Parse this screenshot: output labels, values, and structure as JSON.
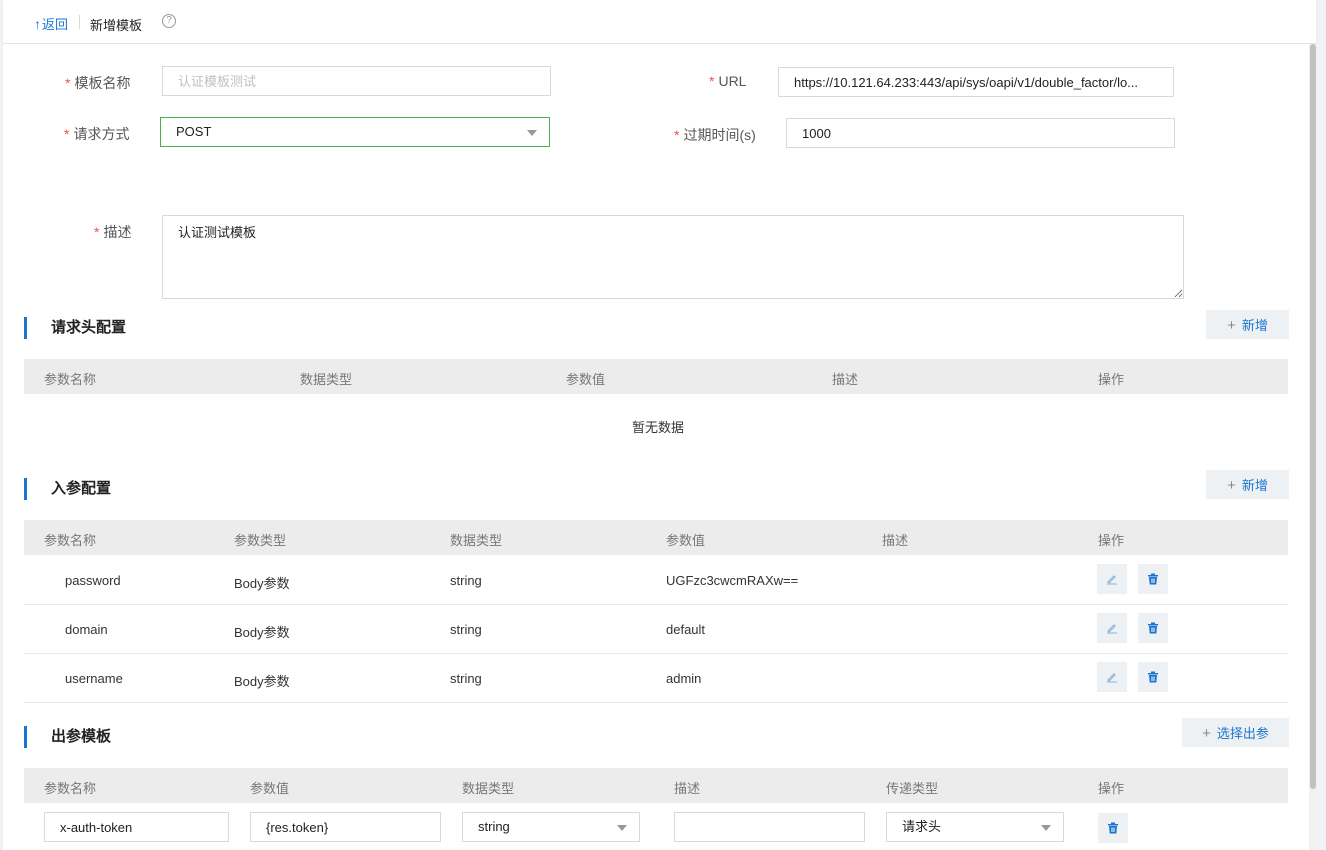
{
  "header": {
    "back_label": "返回",
    "page_title": "新增模板",
    "help_glyph": "?"
  },
  "form": {
    "required_mark": "*",
    "name_label": "模板名称",
    "name_placeholder": "认证模板测试",
    "url_label": "URL",
    "url_value": "https://10.121.64.233:443/api/sys/oapi/v1/double_factor/lo...",
    "method_label": "请求方式",
    "method_value": "POST",
    "expire_label": "过期时间(s)",
    "expire_value": "1000",
    "desc_label": "描述",
    "desc_value": "认证测试模板"
  },
  "headers_section": {
    "title": "请求头配置",
    "add_label": "新增",
    "columns": [
      "参数名称",
      "数据类型",
      "参数值",
      "描述",
      "操作"
    ],
    "empty_text": "暂无数据"
  },
  "params_section": {
    "title": "入参配置",
    "add_label": "新增",
    "columns": [
      "参数名称",
      "参数类型",
      "数据类型",
      "参数值",
      "描述",
      "操作"
    ],
    "rows": [
      {
        "name": "password",
        "param_type": "Body参数",
        "data_type": "string",
        "value": "UGFzc3cwcmRAXw=="
      },
      {
        "name": "domain",
        "param_type": "Body参数",
        "data_type": "string",
        "value": "default"
      },
      {
        "name": "username",
        "param_type": "Body参数",
        "data_type": "string",
        "value": "admin"
      }
    ]
  },
  "output_section": {
    "title": "出参模板",
    "add_label": "选择出参",
    "columns": [
      "参数名称",
      "参数值",
      "数据类型",
      "描述",
      "传递类型",
      "操作"
    ],
    "row": {
      "name": "x-auth-token",
      "value": "{res.token}",
      "data_type": "string",
      "desc": "",
      "transfer_type": "请求头"
    }
  },
  "colors": {
    "accent": "#1a75d2",
    "required": "#f05050",
    "focus": "#4caf50",
    "header_bg": "#ececec"
  }
}
